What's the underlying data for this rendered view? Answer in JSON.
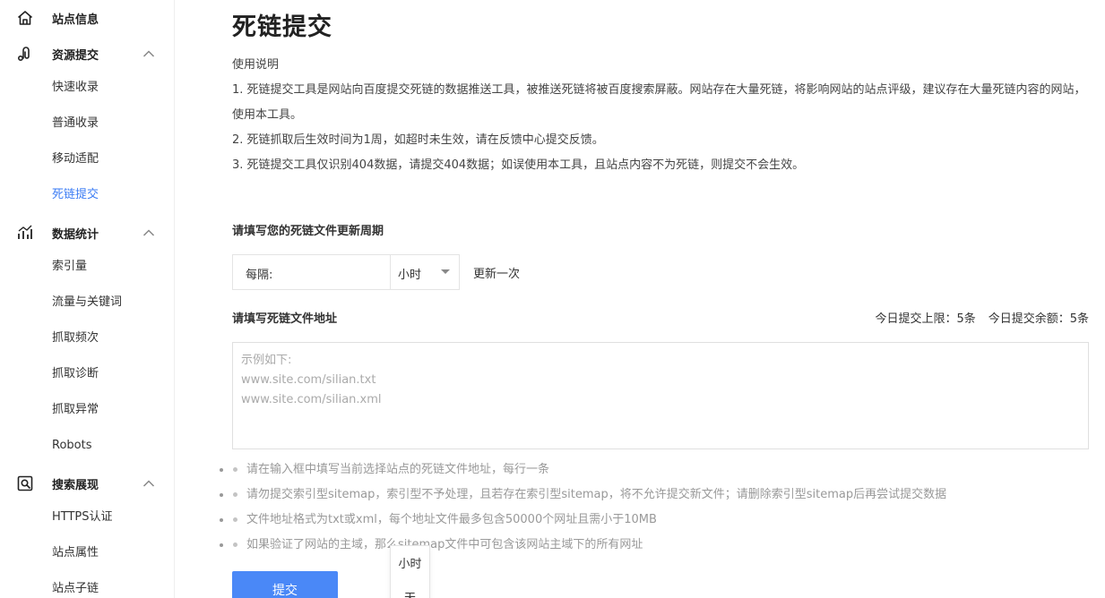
{
  "sidebar": {
    "groups": [
      {
        "label": "站点信息",
        "icon": "home-icon",
        "items": []
      },
      {
        "label": "资源提交",
        "icon": "resource-submit-icon",
        "items": [
          "快速收录",
          "普通收录",
          "移动适配",
          "死链提交"
        ]
      },
      {
        "label": "数据统计",
        "icon": "stats-chart-icon",
        "items": [
          "索引量",
          "流量与关键词",
          "抓取频次",
          "抓取诊断",
          "抓取异常",
          "Robots"
        ]
      },
      {
        "label": "搜索展现",
        "icon": "search-display-icon",
        "items": [
          "HTTPS认证",
          "站点属性",
          "站点子链"
        ]
      }
    ],
    "active_item": "死链提交"
  },
  "main": {
    "title": "死链提交",
    "instructions": {
      "heading": "使用说明",
      "lines": [
        "1. 死链提交工具是网站向百度提交死链的数据推送工具，被推送死链将被百度搜索屏蔽。网站存在大量死链，将影响网站的站点评级，建议存在大量死链内容的网站，使用本工具。",
        "2. 死链抓取后生效时间为1周，如超时未生效，请在反馈中心提交反馈。",
        "3. 死链提交工具仅识别404数据，请提交404数据；如误使用本工具，且站点内容不为死链，则提交不会生效。"
      ]
    },
    "period_label": "请填写您的死链文件更新周期",
    "interval_prefix": "每隔:",
    "interval_unit": "小时",
    "interval_suffix": "更新一次",
    "unit_options": [
      "小时",
      "天"
    ],
    "address_label": "请填写死链文件地址",
    "quota_limit": "今日提交上限：5条",
    "quota_remaining": "今日提交余额：5条",
    "textarea_placeholder": "示例如下:\nwww.site.com/silian.txt\nwww.site.com/silian.xml",
    "notes": [
      "请在输入框中填写当前选择站点的死链文件地址，每行一条",
      "请勿提交索引型sitemap，索引型不予处理，且若存在索引型sitemap，将不允许提交新文件；请删除索引型sitemap后再尝试提交数据",
      "文件地址格式为txt或xml，每个地址文件最多包含50000个网址且需小于10MB",
      "如果验证了网站的主域，那么sitemap文件中可包含该网站主域下的所有网址"
    ],
    "submit_label": "提交"
  },
  "colors": {
    "accent": "#4a88f7",
    "active_link": "#3b7cf4",
    "note_text": "#999999"
  }
}
